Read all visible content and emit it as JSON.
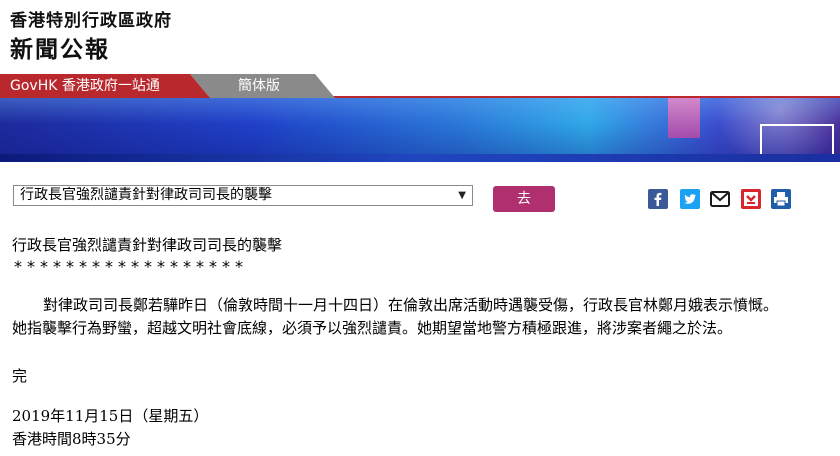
{
  "header": {
    "gov_name": "香港特別行政區政府",
    "site_title": "新聞公報"
  },
  "tabs": {
    "govhk_label": "GovHK 香港政府一站通",
    "simplified_label": "簡体版"
  },
  "nav": {
    "selected_article": "行政長官強烈譴責針對律政司司長的襲擊",
    "go_label": "去"
  },
  "share_icons": [
    "facebook-icon",
    "twitter-icon",
    "email-icon",
    "bookmark-icon",
    "print-icon"
  ],
  "colors": {
    "govhk_tab": "#b8282d",
    "simplified_tab": "#8a8a8a",
    "go_button": "#b0306f"
  },
  "article": {
    "headline": "行政長官強烈譴責針對律政司司長的襲擊",
    "stars": "******************",
    "paragraph_line1": "對律政司司長鄭若驊昨日（倫敦時間十一月十四日）在倫敦出席活動時遇襲受傷，行政長官林鄭月娥表示憤慨。",
    "paragraph_line2": "她指襲擊行為野蠻，超越文明社會底線，必須予以強烈譴責。她期望當地警方積極跟進，將涉案者繩之於法。",
    "end_mark": "完",
    "date": "2019年11月15日（星期五）",
    "time": "香港時間8時35分"
  }
}
